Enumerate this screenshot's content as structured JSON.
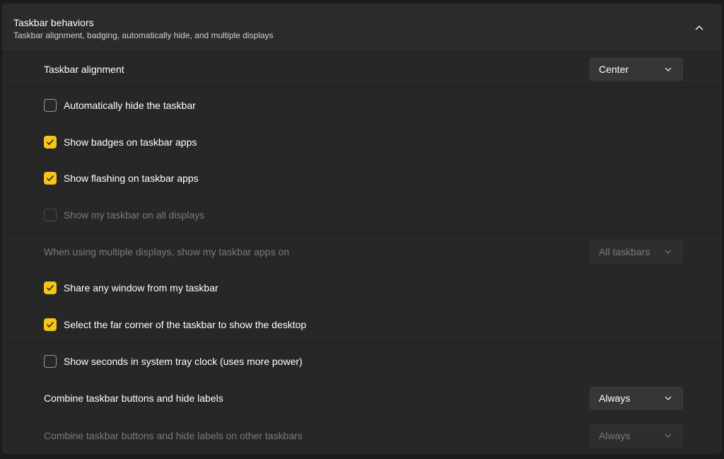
{
  "header": {
    "title": "Taskbar behaviors",
    "subtitle": "Taskbar alignment, badging, automatically hide, and multiple displays"
  },
  "rows": [
    {
      "label": "Taskbar alignment",
      "dropdown": "Center"
    },
    {
      "label": "Automatically hide the taskbar",
      "checked": false
    },
    {
      "label": "Show badges on taskbar apps",
      "checked": true
    },
    {
      "label": "Show flashing on taskbar apps",
      "checked": true
    },
    {
      "label": "Show my taskbar on all displays",
      "checked": false,
      "disabled": true
    },
    {
      "label": "When using multiple displays, show my taskbar apps on",
      "dropdown": "All taskbars",
      "disabled": true
    },
    {
      "label": "Share any window from my taskbar",
      "checked": true
    },
    {
      "label": "Select the far corner of the taskbar to show the desktop",
      "checked": true
    },
    {
      "label": "Show seconds in system tray clock (uses more power)",
      "checked": false
    },
    {
      "label": "Combine taskbar buttons and hide labels",
      "dropdown": "Always"
    },
    {
      "label": "Combine taskbar buttons and hide labels on other taskbars",
      "dropdown": "Always",
      "disabled": true
    }
  ],
  "colors": {
    "accent": "#f5c518",
    "background": "#272727"
  }
}
